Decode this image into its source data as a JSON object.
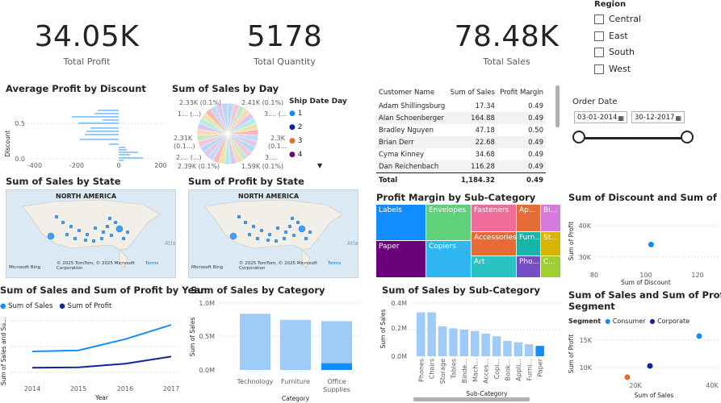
{
  "cards": {
    "profit": {
      "value": "34.05K",
      "label": "Total Profit"
    },
    "quantity": {
      "value": "5178",
      "label": "Total Quantity"
    },
    "sales": {
      "value": "78.48K",
      "label": "Total Sales"
    }
  },
  "region_slicer": {
    "title": "Region",
    "items": [
      "Central",
      "East",
      "South",
      "West"
    ]
  },
  "order_date": {
    "title": "Order Date",
    "start": "03-01-2014",
    "end": "30-12-2017"
  },
  "titles": {
    "avg_profit_discount": "Average Profit by Discount",
    "sales_by_day": "Sum of Sales by Day",
    "sales_by_state": "Sum of Sales by State",
    "profit_by_state": "Sum of Profit by State",
    "pm_subcat": "Profit Margin by Sub-Category",
    "disc_profit": "Sum of Discount and Sum of Profit",
    "sales_profit_year": "Sum of Sales and Sum of Profit by Year",
    "sales_category": "Sum of Sales by Category",
    "sales_subcat": "Sum of Sales by Sub-Category",
    "sales_profit_segment_1": "Sum of Sales and Sum of Profit by",
    "sales_profit_segment_2": "Segment"
  },
  "map": {
    "region_label": "NORTH AMERICA",
    "credits": "© 2025 TomTom, © 2025 Microsoft Corporation",
    "terms": "Terms",
    "brand": "Microsoft Bing",
    "atl": "Atla"
  },
  "pie_legend": {
    "title": "Ship Date Day",
    "items": [
      "1",
      "2",
      "3",
      "4"
    ],
    "colors": [
      "#118dff",
      "#12239e",
      "#e66c37",
      "#6b007b"
    ]
  },
  "pie_labels": [
    "2.33K (0.1%)",
    "2.41K (0.1%)",
    "1... (...)",
    "3.... (...",
    "2.31K",
    "(0.1...)",
    "2.3K",
    "(0.1...)",
    "2.... (...)",
    "2.39K (0.1%)",
    "1.59K (0.1%)",
    "3...."
  ],
  "customer_table": {
    "headers": [
      "Customer Name",
      "Sum of Sales",
      "Profit Margin"
    ],
    "rows": [
      [
        "Adam Shillingsburg",
        "17.34",
        "0.49"
      ],
      [
        "Alan Schoenberger",
        "164.88",
        "0.49"
      ],
      [
        "Bradley Nguyen",
        "47.18",
        "0.50"
      ],
      [
        "Brian Derr",
        "22.68",
        "0.49"
      ],
      [
        "Cyma Kinney",
        "34.68",
        "0.49"
      ],
      [
        "Dan Reichenbach",
        "116.28",
        "0.49"
      ]
    ],
    "total": [
      "Total",
      "1,184.32",
      "0.49"
    ]
  },
  "treemap_labels": [
    "Labels",
    "Envelopes",
    "Fasteners",
    "Ap...",
    "Bi...",
    "Paper",
    "Copiers",
    "Accessories",
    "Furn...",
    "St...",
    "Art",
    "Pho...",
    "C..."
  ],
  "chart_data": [
    {
      "id": "avg_profit_discount",
      "type": "bar",
      "x_ticks": [
        "-400",
        "-200",
        "0",
        "200"
      ],
      "y_ticks": [
        "0.5",
        "0.0"
      ],
      "ylabel": "Discount",
      "xlim": [
        -400,
        250
      ]
    },
    {
      "id": "sales_profit_year",
      "type": "line",
      "x": [
        "2014",
        "2015",
        "2016",
        "2017"
      ],
      "xlabel": "Year",
      "ylabel": "Sum of Sales and Su...",
      "series": [
        {
          "name": "Sum of Sales",
          "color": "#118dff",
          "values": [
            15,
            15.5,
            21,
            28
          ]
        },
        {
          "name": "Sum of Profit",
          "color": "#12239e",
          "values": [
            7,
            7.2,
            9,
            12.5
          ]
        }
      ]
    },
    {
      "id": "sales_category",
      "type": "bar",
      "categories": [
        "Technology",
        "Furniture",
        "Office\nSupplies"
      ],
      "cat_labels": [
        "Technology",
        "Furniture",
        "Office",
        "Supplies"
      ],
      "values": [
        0.84,
        0.75,
        0.73
      ],
      "highlight": [
        0,
        0,
        0.1
      ],
      "y_ticks": [
        "1.0M",
        "0.5M",
        "0.0M"
      ],
      "ylim": [
        0,
        1.0
      ],
      "xlabel": "Category",
      "ylabel": "Sum of Sales"
    },
    {
      "id": "sales_subcat",
      "type": "bar",
      "categories": [
        "Phones",
        "Chairs",
        "Storage",
        "Tables",
        "Binde...",
        "Mach...",
        "Acces...",
        "Copi...",
        "Book...",
        "Appli...",
        "Furni...",
        "Paper"
      ],
      "values": [
        0.33,
        0.33,
        0.225,
        0.21,
        0.2,
        0.19,
        0.17,
        0.15,
        0.115,
        0.105,
        0.09,
        0.078
      ],
      "y_ticks": [
        "0.4M",
        "0.2M",
        "0.0M"
      ],
      "ylim": [
        0,
        0.4
      ],
      "xlabel": "Sub-Category",
      "ylabel": "Sum of Sales"
    },
    {
      "id": "disc_profit",
      "type": "scatter",
      "x_ticks": [
        "80",
        "100",
        "120"
      ],
      "y_ticks": [
        "40K",
        "30K"
      ],
      "xlabel": "Sum of Discount",
      "ylabel": "Sum of Profit",
      "points": [
        [
          102,
          34000
        ]
      ]
    },
    {
      "id": "segment",
      "type": "scatter",
      "legend_title": "Segment",
      "legend": [
        "Consumer",
        "Corporate"
      ],
      "x_ticks": [
        "20K",
        "40K"
      ],
      "y_ticks": [
        "15K",
        "10K"
      ],
      "xlabel": "Sum of Sales",
      "ylabel": "Sum of Profit"
    }
  ]
}
